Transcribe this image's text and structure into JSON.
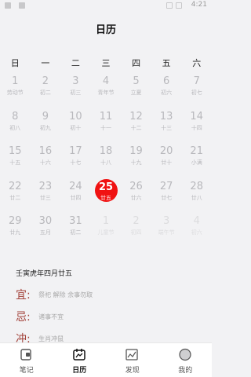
{
  "status_bar": {
    "time": "4:21"
  },
  "header": {
    "title": "日历"
  },
  "weekdays": [
    "日",
    "一",
    "二",
    "三",
    "四",
    "五",
    "六"
  ],
  "calendar": {
    "weeks": [
      [
        {
          "d": "1",
          "l": "劳动节"
        },
        {
          "d": "2",
          "l": "初二"
        },
        {
          "d": "3",
          "l": "初三"
        },
        {
          "d": "4",
          "l": "青年节"
        },
        {
          "d": "5",
          "l": "立夏"
        },
        {
          "d": "6",
          "l": "初六"
        },
        {
          "d": "7",
          "l": "初七"
        }
      ],
      [
        {
          "d": "8",
          "l": "初八"
        },
        {
          "d": "9",
          "l": "初九"
        },
        {
          "d": "10",
          "l": "初十"
        },
        {
          "d": "11",
          "l": "十一"
        },
        {
          "d": "12",
          "l": "十二"
        },
        {
          "d": "13",
          "l": "十三"
        },
        {
          "d": "14",
          "l": "十四"
        }
      ],
      [
        {
          "d": "15",
          "l": "十五"
        },
        {
          "d": "16",
          "l": "十六"
        },
        {
          "d": "17",
          "l": "十七"
        },
        {
          "d": "18",
          "l": "十八"
        },
        {
          "d": "19",
          "l": "十九"
        },
        {
          "d": "20",
          "l": "廿十"
        },
        {
          "d": "21",
          "l": "小满"
        }
      ],
      [
        {
          "d": "22",
          "l": "廿二"
        },
        {
          "d": "23",
          "l": "廿三"
        },
        {
          "d": "24",
          "l": "廿四"
        },
        {
          "d": "25",
          "l": "廿五",
          "today": true
        },
        {
          "d": "26",
          "l": "廿六"
        },
        {
          "d": "27",
          "l": "廿七"
        },
        {
          "d": "28",
          "l": "廿八"
        }
      ],
      [
        {
          "d": "29",
          "l": "廿九"
        },
        {
          "d": "30",
          "l": "五月"
        },
        {
          "d": "31",
          "l": "初二"
        },
        {
          "d": "1",
          "l": "儿童节",
          "other": true
        },
        {
          "d": "2",
          "l": "初四",
          "other": true
        },
        {
          "d": "3",
          "l": "端午节",
          "other": true
        },
        {
          "d": "4",
          "l": "初六",
          "other": true
        }
      ]
    ]
  },
  "almanac": {
    "ganzhi": "壬寅虎年四月廿五",
    "yi_label": "宜:",
    "yi_text": "祭祀 解除 余事勿取",
    "ji_label": "忌:",
    "ji_text": "诸事不宜",
    "chong_label": "冲:",
    "chong_text": "生肖冲鼠"
  },
  "tabs": [
    {
      "label": "笔记",
      "icon": "note-icon"
    },
    {
      "label": "日历",
      "icon": "calendar-icon",
      "active": true
    },
    {
      "label": "发现",
      "icon": "discover-icon"
    },
    {
      "label": "我的",
      "icon": "profile-icon"
    }
  ]
}
